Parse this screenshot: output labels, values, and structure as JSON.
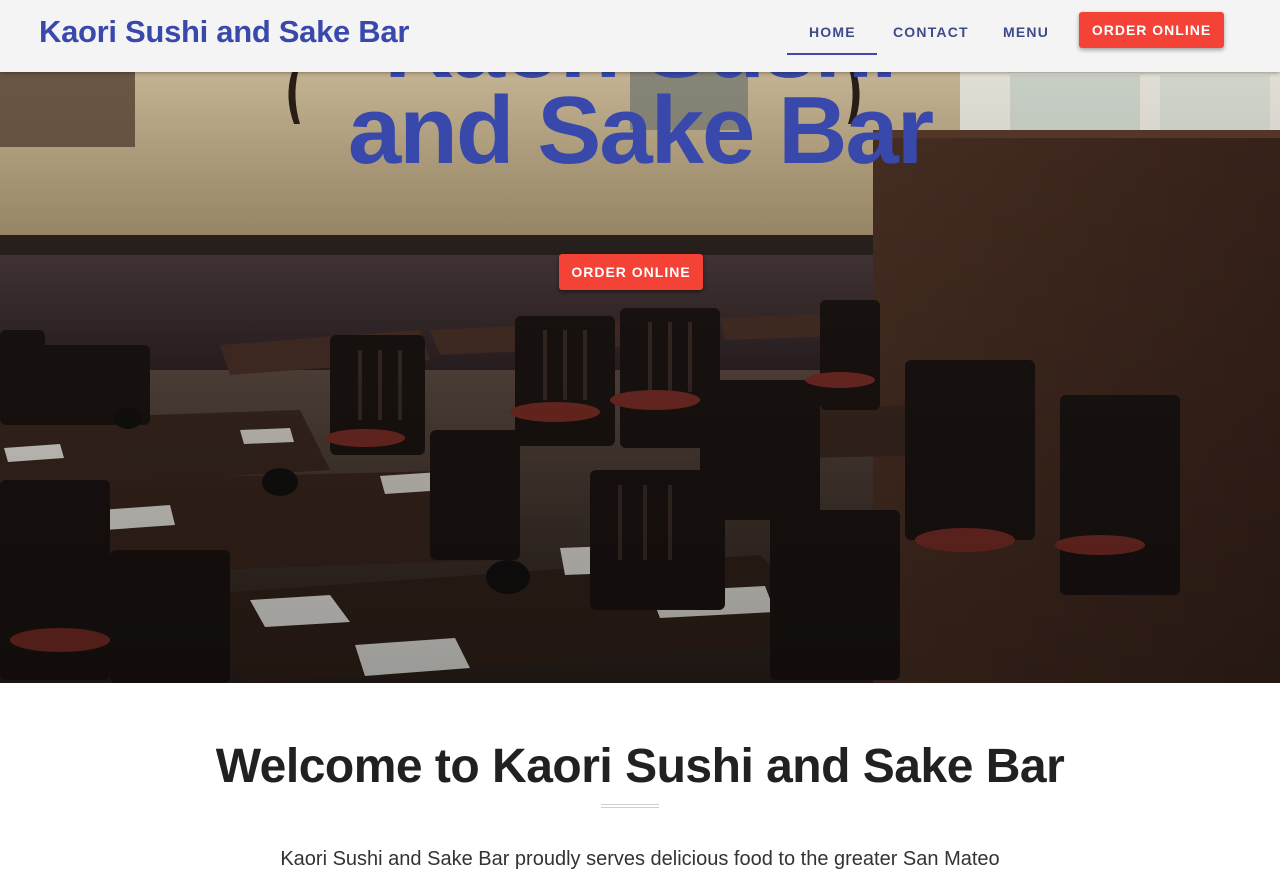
{
  "header": {
    "brand": "Kaori Sushi and Sake Bar",
    "nav": {
      "home": "HOME",
      "contact": "CONTACT",
      "menu": "MENU"
    },
    "active_nav": "home",
    "order_button": "ORDER ONLINE"
  },
  "hero": {
    "title_line1": "Kaori Sushi",
    "title_line2": "and Sake Bar",
    "order_button": "ORDER ONLINE",
    "image": "restaurant-dining-room-photo"
  },
  "welcome": {
    "title": "Welcome to Kaori Sushi and Sake Bar",
    "text": "Kaori Sushi and Sake Bar proudly serves delicious food to the greater San Mateo"
  },
  "colors": {
    "brand_blue": "#3949ab",
    "accent_red": "#f44336",
    "header_bg": "#f4f4f4",
    "heading_dark": "#212121"
  }
}
